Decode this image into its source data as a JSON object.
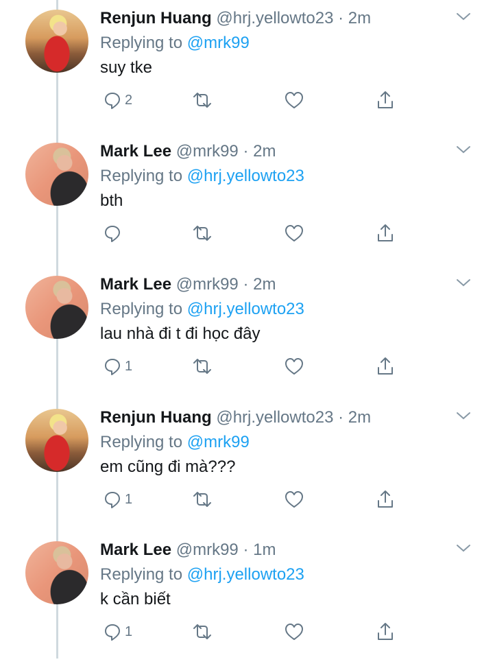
{
  "colors": {
    "name": "#14171a",
    "secondary": "#657786",
    "link": "#1da1f2",
    "thread_line": "#cfd9de"
  },
  "icons": {
    "more": "chevron-down-icon",
    "reply": "reply-icon",
    "retweet": "retweet-icon",
    "like": "like-icon",
    "share": "share-icon"
  },
  "tweets": [
    {
      "name": "Renjun Huang",
      "handle": "@hrj.yellowto23",
      "sep": " · ",
      "time": "2m",
      "replying_prefix": "Replying to ",
      "replying_to": "@mrk99",
      "text": "suy tke",
      "reply_count": "2"
    },
    {
      "name": "Mark Lee",
      "handle": "@mrk99",
      "sep": " · ",
      "time": "2m",
      "replying_prefix": "Replying to ",
      "replying_to": "@hrj.yellowto23",
      "text": "bth",
      "reply_count": ""
    },
    {
      "name": "Mark Lee",
      "handle": "@mrk99",
      "sep": " · ",
      "time": "2m",
      "replying_prefix": "Replying to ",
      "replying_to": "@hrj.yellowto23",
      "text": "lau nhà đi t đi học đây",
      "reply_count": "1"
    },
    {
      "name": "Renjun Huang",
      "handle": "@hrj.yellowto23",
      "sep": " · ",
      "time": "2m",
      "replying_prefix": "Replying to ",
      "replying_to": "@mrk99",
      "text": "em cũng đi mà???",
      "reply_count": "1"
    },
    {
      "name": "Mark Lee",
      "handle": "@mrk99",
      "sep": " · ",
      "time": "1m",
      "replying_prefix": "Replying to ",
      "replying_to": "@hrj.yellowto23",
      "text": "k cần biết",
      "reply_count": "1"
    }
  ]
}
